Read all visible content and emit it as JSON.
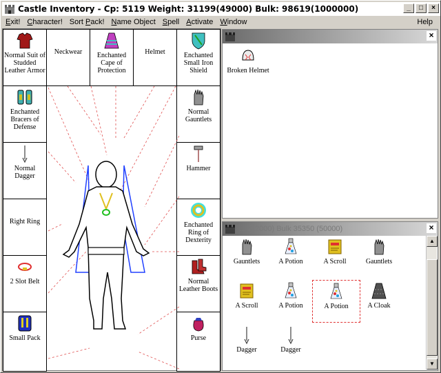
{
  "window": {
    "title": "Castle Inventory - Cp: 5119 Weight: 31199(49000) Bulk: 98619(1000000)",
    "minimize": "_",
    "maximize": "□",
    "close": "×"
  },
  "menu": {
    "items": [
      {
        "pre": "E",
        "rest": "xit!",
        "u_first": true
      },
      {
        "pre": "C",
        "rest": "haracter!",
        "u_first": true
      },
      {
        "pre": "Sort ",
        "u": "P",
        "post": "ack!"
      },
      {
        "pre": "",
        "u": "N",
        "post": "ame Object"
      },
      {
        "pre": "",
        "u": "S",
        "post": "pell"
      },
      {
        "pre": "",
        "u": "A",
        "post": "ctivate"
      },
      {
        "pre": "",
        "u": "W",
        "post": "indow"
      }
    ],
    "help": "Help"
  },
  "slots": {
    "armor": "Normal Suit of Studded Leather Armor",
    "neckwear": "Neckwear",
    "cape": "Enchanted Cape of Protection",
    "helmet": "Helmet",
    "shield": "Enchanted Small Iron Shield",
    "bracers": "Enchanted Bracers of Defense",
    "gauntlets": "Normal Gauntlets",
    "dagger": "Normal Dagger",
    "hammer": "Hammer",
    "right_ring": "Right Ring",
    "left_ring": "Enchanted Ring of Dexterity",
    "belt": "2 Slot Belt",
    "boots": "Normal Leather Boots",
    "pack": "Small Pack",
    "purse": "Purse"
  },
  "ground_panel": {
    "items": [
      "Broken Helmet"
    ]
  },
  "pack_panel": {
    "title": "... (12000) Bulk 35350 (50000)",
    "items": [
      "Gauntlets",
      "A Potion",
      "A Scroll",
      "Gauntlets",
      "A Scroll",
      "A Potion",
      "A Potion",
      "A Cloak",
      "Dagger",
      "Dagger"
    ]
  },
  "colors": {
    "cape": "#2040ff",
    "amulet": "#20c020",
    "selection": "#e03030",
    "laces": "#e05050"
  }
}
